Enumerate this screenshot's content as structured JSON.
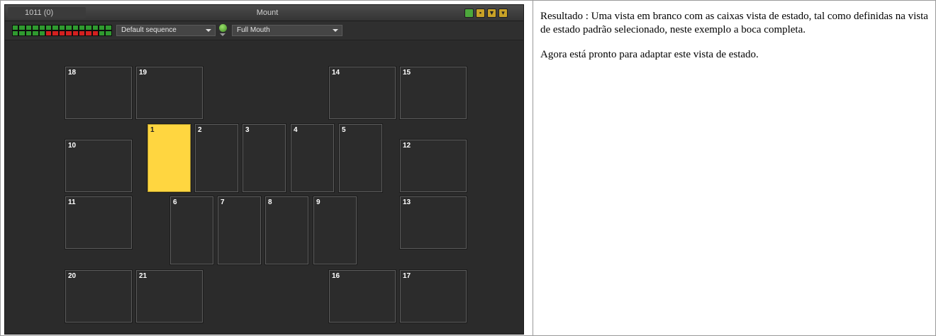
{
  "app": {
    "counter": "1011 (0)",
    "title": "Mount",
    "title_buttons": [
      "status-green-icon",
      "trash-icon",
      "filter-icon",
      "chevron-down-icon"
    ],
    "sequence_indicator": {
      "top_row": [
        "g",
        "g",
        "g",
        "g",
        "g",
        "g",
        "g",
        "g",
        "g",
        "g",
        "g",
        "g",
        "g",
        "g",
        "g"
      ],
      "bottom_row": [
        "g",
        "g",
        "g",
        "g",
        "g",
        "r",
        "r",
        "r",
        "r",
        "r",
        "r",
        "r",
        "r",
        "g",
        "g"
      ]
    },
    "sequence_dropdown": "Default sequence",
    "view_dropdown": "Full Mouth",
    "boxes": [
      {
        "id": "18",
        "label": "18"
      },
      {
        "id": "19",
        "label": "19"
      },
      {
        "id": "14",
        "label": "14"
      },
      {
        "id": "15",
        "label": "15"
      },
      {
        "id": "10",
        "label": "10"
      },
      {
        "id": "1",
        "label": "1",
        "selected": true
      },
      {
        "id": "2",
        "label": "2"
      },
      {
        "id": "3",
        "label": "3"
      },
      {
        "id": "4",
        "label": "4"
      },
      {
        "id": "5",
        "label": "5"
      },
      {
        "id": "12",
        "label": "12"
      },
      {
        "id": "11",
        "label": "11"
      },
      {
        "id": "6",
        "label": "6"
      },
      {
        "id": "7",
        "label": "7"
      },
      {
        "id": "8",
        "label": "8"
      },
      {
        "id": "9",
        "label": "9"
      },
      {
        "id": "13",
        "label": "13"
      },
      {
        "id": "20",
        "label": "20"
      },
      {
        "id": "21",
        "label": "21"
      },
      {
        "id": "16",
        "label": "16"
      },
      {
        "id": "17",
        "label": "17"
      }
    ]
  },
  "description": {
    "paragraph1": "Resultado : Uma vista em branco com as caixas vista de estado, tal como definidas na vista de estado padrão selecionado, neste exemplo a boca completa.",
    "paragraph2": "Agora está pronto para adaptar este vista de estado."
  },
  "colors": {
    "selected_box": "#ffd640",
    "app_background": "#2b2b2b",
    "seq_green": "#2f9a2f",
    "seq_red": "#d42020"
  }
}
